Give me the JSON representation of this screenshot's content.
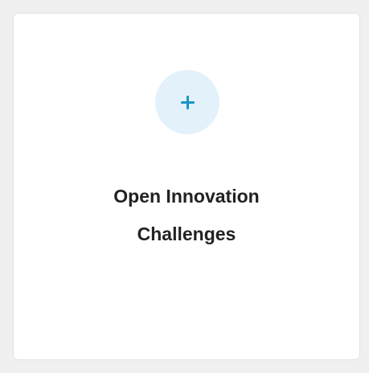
{
  "card": {
    "title": "Open Innovation\nChallenges",
    "icon": "plus-icon"
  },
  "colors": {
    "page_background": "#f0f0f0",
    "card_background": "#ffffff",
    "icon_circle": "#e3f2fa",
    "icon_accent": "#1a95c8",
    "title_text": "#222222"
  }
}
